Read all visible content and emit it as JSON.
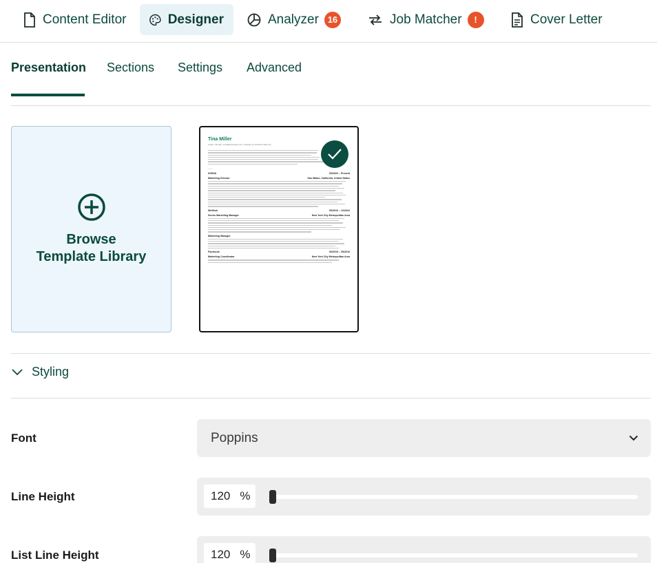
{
  "nav": {
    "items": [
      {
        "label": "Content Editor",
        "icon": "document-icon"
      },
      {
        "label": "Designer",
        "icon": "palette-icon",
        "active": true
      },
      {
        "label": "Analyzer",
        "icon": "pie-chart-icon",
        "badge": "16"
      },
      {
        "label": "Job Matcher",
        "icon": "arrows-swap-icon",
        "badge": "!"
      },
      {
        "label": "Cover Letter",
        "icon": "document-lines-icon"
      }
    ]
  },
  "tabs": [
    "Presentation",
    "Sections",
    "Settings",
    "Advanced"
  ],
  "templates": {
    "browse_label_line1": "Browse",
    "browse_label_line2": "Template Library",
    "selected_preview": {
      "name": "Tina Miller",
      "contact": "Austin, Florida • email@example.com • linkedin.com/in/tina-miller-fuq",
      "jobs": [
        {
          "company": "NVIDIA",
          "dates": "03/2020 – Present",
          "title": "Marketing Director",
          "location": "San Mateo, California, United States"
        },
        {
          "company": "WeWork",
          "dates": "09/2016 – 12/2022",
          "title": "Senior Marketing Manager",
          "location": "New York City Metropolitan Area"
        },
        {
          "company": "",
          "dates": "",
          "title": "Marketing Manager",
          "location": ""
        },
        {
          "company": "Facebook",
          "dates": "06/2015 – 09/2016",
          "title": "Marketing Coordinator",
          "location": "New York City Metropolitan Area"
        }
      ]
    }
  },
  "styling": {
    "section_label": "Styling",
    "font": {
      "label": "Font",
      "value": "Poppins"
    },
    "line_height": {
      "label": "Line Height",
      "value": "120",
      "unit": "%",
      "level": 0.0
    },
    "list_line_height": {
      "label": "List Line Height",
      "value": "120",
      "unit": "%",
      "level": 0.0
    }
  },
  "colors": {
    "accent": "#0b4d40",
    "badge": "#e8532b",
    "active_tab_bg": "#e8f3f8"
  }
}
